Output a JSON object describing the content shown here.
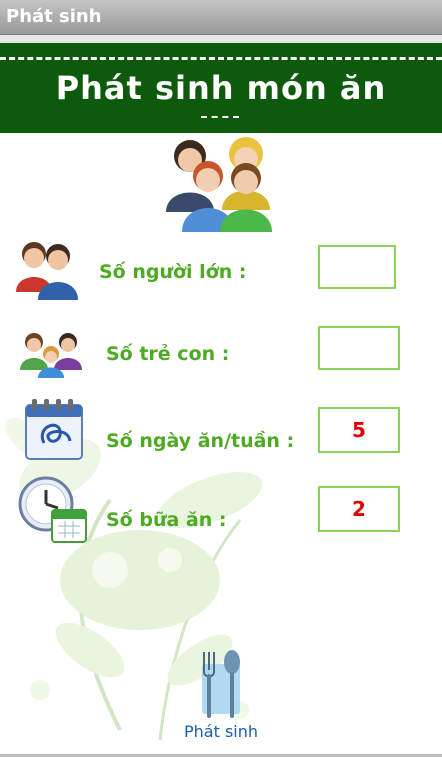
{
  "window": {
    "title": "Phát sinh"
  },
  "header": {
    "title": "Phát sinh món ăn"
  },
  "form": {
    "adults": {
      "label": "Số người lớn :",
      "value": ""
    },
    "children": {
      "label": "Số trẻ con :",
      "value": ""
    },
    "days_per_week": {
      "label": "Số ngày ăn/tuần :",
      "value": "5"
    },
    "meals": {
      "label": "Số bữa ăn :",
      "value": "2"
    }
  },
  "actions": {
    "generate_label": "Phát sinh"
  },
  "colors": {
    "banner": "#0d5a0d",
    "label_green": "#4cab22",
    "input_border": "#8ccf5a",
    "value_red": "#e00000",
    "button_text": "#1a5fb4"
  },
  "icons": {
    "group": "people-group-icon",
    "adults": "adults-icon",
    "children": "children-icon",
    "calendar": "calendar-icon",
    "clock": "clock-calendar-icon",
    "generate": "cutlery-icon"
  }
}
